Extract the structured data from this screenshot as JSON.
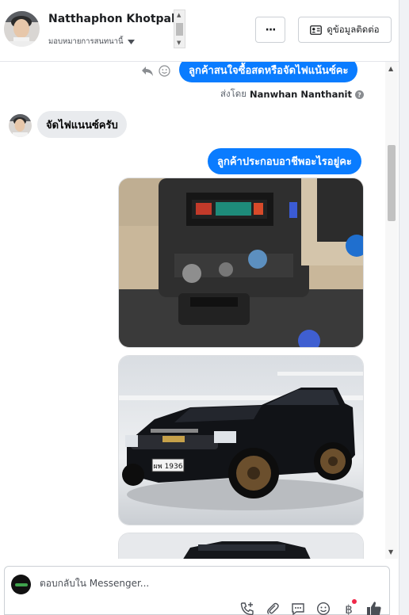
{
  "header": {
    "contact_name": "Natthaphon Khotpakdee",
    "assign_label": "มอบหมายการสนทนานี้",
    "more_label": "···",
    "contact_info_label": "ดูข้อมูลติดต่อ"
  },
  "messages": {
    "top_out": "ลูกค้าสนใจซื้อสดหรือจัดไฟแน้นซ์คะ",
    "sent_by_prefix": "ส่งโดย",
    "sent_by_name": "Nanwhan Nanthanit",
    "customer_reply": "จัดไฟแนนซ์ครับ",
    "second_out": "ลูกค้าประกอบอาชีพอะไรอยู่คะ"
  },
  "photos": [
    {
      "name": "car-interior-photo",
      "plate": ""
    },
    {
      "name": "black-pickup-truck-photo",
      "plate": "ผพ 1936"
    },
    {
      "name": "car-photo-partial",
      "plate": ""
    }
  ],
  "composer": {
    "placeholder": "ตอบกลับใน Messenger..."
  },
  "icons": {
    "accent": "#0a7cff",
    "tools": [
      "phone-add-icon",
      "paperclip-icon",
      "saved-reply-icon",
      "emoji-icon",
      "baht-icon",
      "like-icon"
    ]
  }
}
